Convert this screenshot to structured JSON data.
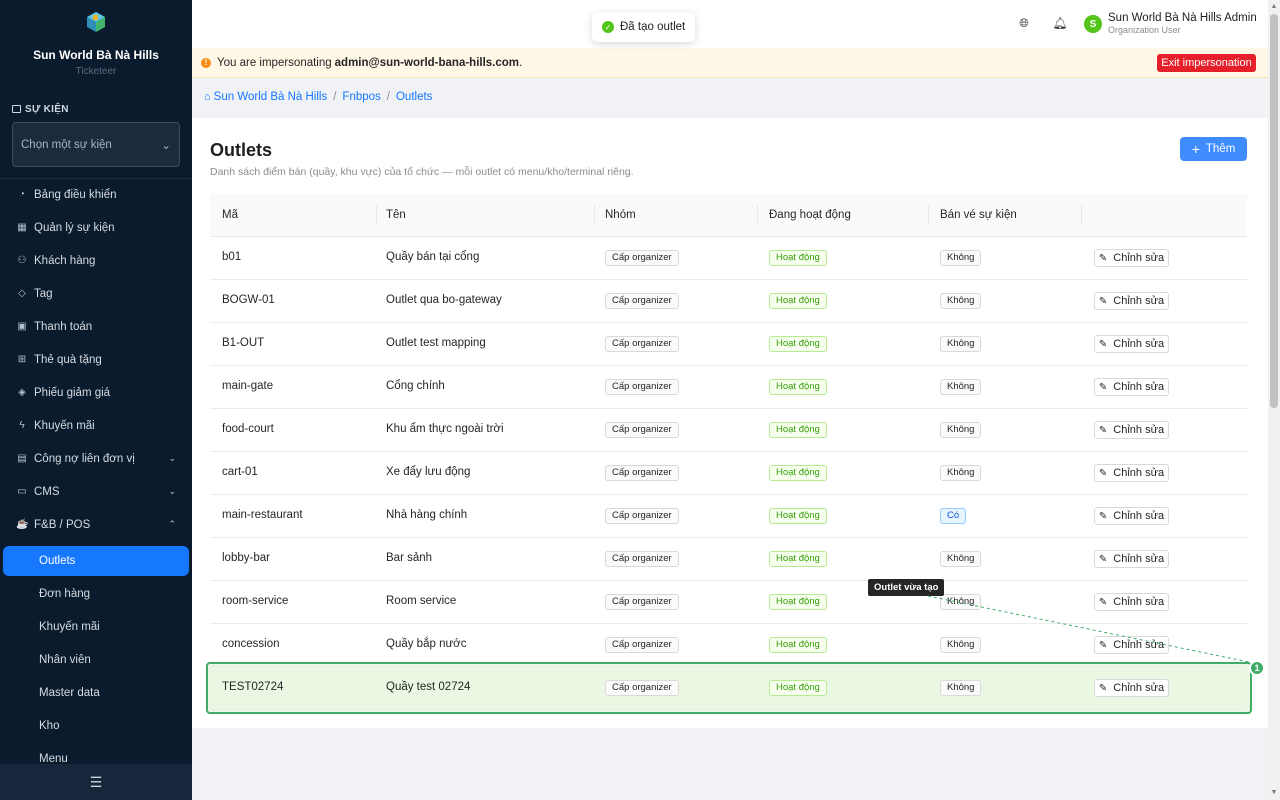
{
  "sidebar": {
    "org_name": "Sun World Bà Nà Hills",
    "org_sub": "Ticketeer",
    "section_label": "SỰ KIỆN",
    "event_select_placeholder": "Chọn một sự kiện",
    "items": [
      {
        "label": "Bảng điều khiển",
        "icon": "dashboard-icon"
      },
      {
        "label": "Quản lý sự kiện",
        "icon": "calendar-icon"
      },
      {
        "label": "Khách hàng",
        "icon": "users-icon"
      },
      {
        "label": "Tag",
        "icon": "tag-icon"
      },
      {
        "label": "Thanh toán",
        "icon": "payment-icon"
      },
      {
        "label": "Thẻ quà tặng",
        "icon": "gift-icon"
      },
      {
        "label": "Phiếu giảm giá",
        "icon": "coupon-icon"
      },
      {
        "label": "Khuyến mãi",
        "icon": "lightning-icon"
      },
      {
        "label": "Công nợ liên đơn vị",
        "icon": "ledger-icon"
      },
      {
        "label": "CMS",
        "icon": "cms-icon"
      },
      {
        "label": "F&B / POS",
        "icon": "coffee-icon"
      }
    ],
    "sub_items": [
      {
        "label": "Outlets",
        "active": true
      },
      {
        "label": "Đơn hàng"
      },
      {
        "label": "Khuyến mãi"
      },
      {
        "label": "Nhân viên"
      },
      {
        "label": "Master data"
      },
      {
        "label": "Kho"
      },
      {
        "label": "Menu"
      }
    ]
  },
  "toast": {
    "message": "Đã tạo outlet"
  },
  "user": {
    "initial": "S",
    "name": "Sun World Bà Nà Hills Admin",
    "role": "Organization User"
  },
  "impersonation": {
    "prefix": "You are impersonating",
    "email": "admin@sun-world-bana-hills.com",
    "suffix": ".",
    "exit_label": "Exit impersonation"
  },
  "breadcrumb": [
    "Sun World Bà Nà Hills",
    "Fnbpos",
    "Outlets"
  ],
  "page": {
    "title": "Outlets",
    "subtitle": "Danh sách điểm bán (quầy, khu vực) của tổ chức — mỗi outlet có menu/kho/terminal riêng.",
    "add_label": "Thêm"
  },
  "table": {
    "headers": [
      "Mã",
      "Tên",
      "Nhóm",
      "Đang hoạt động",
      "Bán vé sự kiện"
    ],
    "edit_label": "Chỉnh sửa",
    "rows": [
      {
        "code": "b01",
        "name": "Quầy bán tại cổng",
        "group": "Cấp organizer",
        "active": "Hoạt động",
        "ticket": "Không"
      },
      {
        "code": "BOGW-01",
        "name": "Outlet qua bo-gateway",
        "group": "Cấp organizer",
        "active": "Hoạt động",
        "ticket": "Không"
      },
      {
        "code": "B1-OUT",
        "name": "Outlet test mapping",
        "group": "Cấp organizer",
        "active": "Hoạt động",
        "ticket": "Không"
      },
      {
        "code": "main-gate",
        "name": "Cổng chính",
        "group": "Cấp organizer",
        "active": "Hoạt động",
        "ticket": "Không"
      },
      {
        "code": "food-court",
        "name": "Khu ẩm thực ngoài trời",
        "group": "Cấp organizer",
        "active": "Hoạt động",
        "ticket": "Không"
      },
      {
        "code": "cart-01",
        "name": "Xe đẩy lưu động",
        "group": "Cấp organizer",
        "active": "Hoạt động",
        "ticket": "Không"
      },
      {
        "code": "main-restaurant",
        "name": "Nhà hàng chính",
        "group": "Cấp organizer",
        "active": "Hoạt động",
        "ticket": "Có"
      },
      {
        "code": "lobby-bar",
        "name": "Bar sảnh",
        "group": "Cấp organizer",
        "active": "Hoạt động",
        "ticket": "Không"
      },
      {
        "code": "room-service",
        "name": "Room service",
        "group": "Cấp organizer",
        "active": "Hoạt động",
        "ticket": "Không"
      },
      {
        "code": "concession",
        "name": "Quầy bắp nước",
        "group": "Cấp organizer",
        "active": "Hoạt động",
        "ticket": "Không"
      },
      {
        "code": "TEST02724",
        "name": "Quầy test 02724",
        "group": "Cấp organizer",
        "active": "Hoạt động",
        "ticket": "Không"
      }
    ]
  },
  "annotation": {
    "tooltip": "Outlet vừa tạo",
    "number": "1"
  }
}
